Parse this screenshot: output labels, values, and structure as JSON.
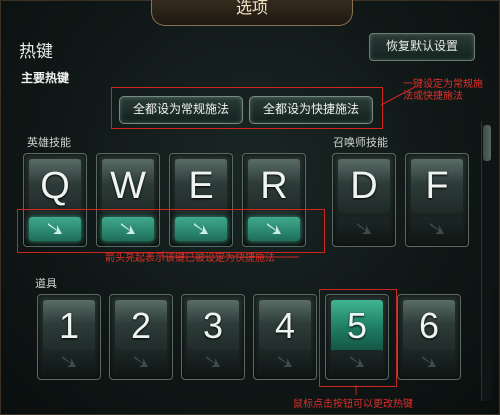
{
  "window": {
    "title": "选项"
  },
  "header": {
    "section_title": "热键",
    "restore_default": "恢复默认设置"
  },
  "main_hotkeys": {
    "label": "主要热键",
    "set_normal": "全都设为常规施法",
    "set_quick": "全都设为快捷施法"
  },
  "hero_skills": {
    "label": "英雄技能",
    "keys": [
      "Q",
      "W",
      "E",
      "R"
    ],
    "quick_cast_enabled": [
      true,
      true,
      true,
      true
    ]
  },
  "summoner_skills": {
    "label": "召唤师技能",
    "keys": [
      "D",
      "F"
    ],
    "quick_cast_enabled": [
      false,
      false
    ]
  },
  "items": {
    "label": "道具",
    "keys": [
      "1",
      "2",
      "3",
      "4",
      "5",
      "6"
    ],
    "selected_index": 4
  },
  "annotations": {
    "top_right": "一键设定为常规施法或快捷施法",
    "arrows": "箭头亮起表示该键已被设定为快捷施法",
    "bottom": "鼠标点击按钮可以更改热键"
  },
  "colors": {
    "accent": "#3ea98c",
    "annotation": "#d0241e"
  }
}
